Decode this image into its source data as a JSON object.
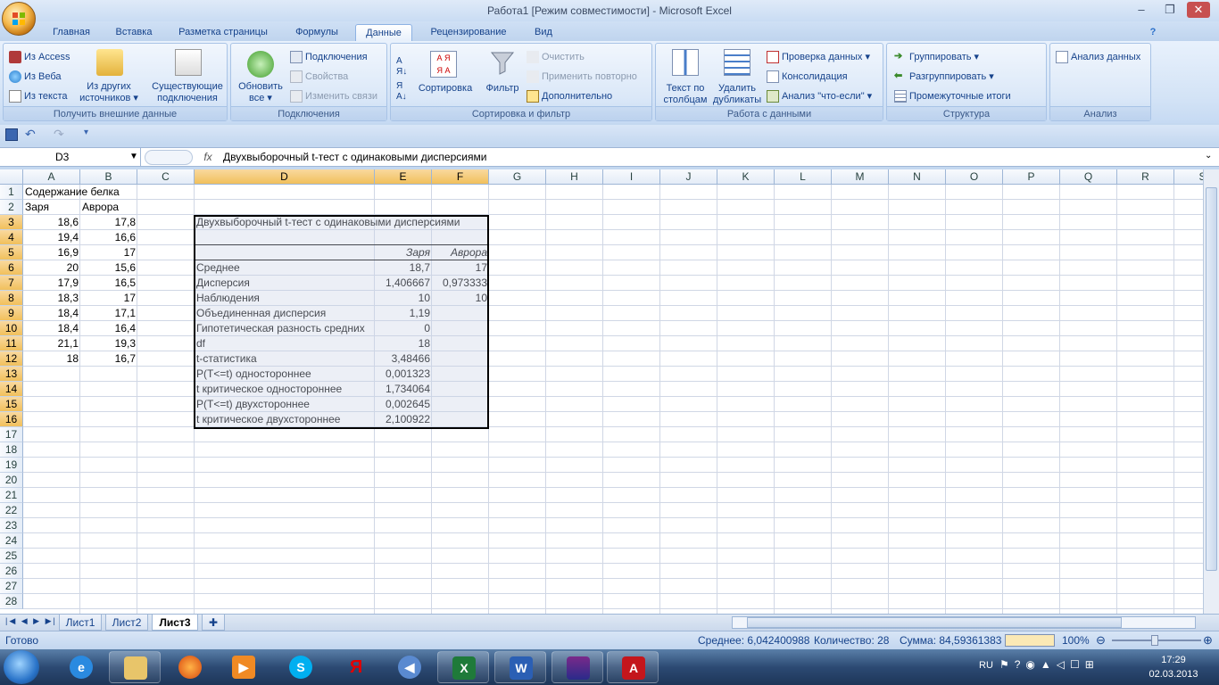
{
  "window": {
    "title": "Работа1  [Режим совместимости] - Microsoft Excel",
    "min": "–",
    "max": "❐",
    "close": "✕"
  },
  "tabs": [
    "Главная",
    "Вставка",
    "Разметка страницы",
    "Формулы",
    "Данные",
    "Рецензирование",
    "Вид"
  ],
  "active_tab": "Данные",
  "ribbon": {
    "g1": {
      "label": "Получить внешние данные",
      "access": "Из Access",
      "web": "Из Веба",
      "text": "Из текста",
      "other1": "Из других",
      "other2": "источников ▾",
      "exist1": "Существующие",
      "exist2": "подключения"
    },
    "g2": {
      "label": "Подключения",
      "refresh1": "Обновить",
      "refresh2": "все ▾",
      "connections": "Подключения",
      "properties": "Свойства",
      "edit_links": "Изменить связи"
    },
    "g3": {
      "label": "Сортировка и фильтр",
      "sort": "Сортировка",
      "filter": "Фильтр",
      "clear": "Очистить",
      "reapply": "Применить повторно",
      "advanced": "Дополнительно"
    },
    "g4": {
      "label": "Работа с данными",
      "ttc1": "Текст по",
      "ttc2": "столбцам",
      "dup1": "Удалить",
      "dup2": "дубликаты",
      "validation": "Проверка данных ▾",
      "consolidate": "Консолидация",
      "whatif": "Анализ \"что-если\" ▾"
    },
    "g5": {
      "label": "Структура",
      "group": "Группировать ▾",
      "ungroup": "Разгруппировать ▾",
      "subtotal": "Промежуточные итоги"
    },
    "g6": {
      "label": "Анализ",
      "analysis": "Анализ данных"
    }
  },
  "formula_bar": {
    "name_box": "D3",
    "fx": "fx",
    "formula": "Двухвыборочный t-тест с одинаковыми дисперсиями"
  },
  "columns": [
    "A",
    "B",
    "C",
    "D",
    "E",
    "F",
    "G",
    "H",
    "I",
    "J",
    "K",
    "L",
    "M",
    "N",
    "O",
    "P",
    "Q",
    "R",
    "S"
  ],
  "cells": {
    "A1": "Содержание белка",
    "A2": "Заря",
    "B2": "Аврора",
    "A3": "18,6",
    "B3": "17,8",
    "A4": "19,4",
    "B4": "16,6",
    "A5": "16,9",
    "B5": "17",
    "A6": "20",
    "B6": "15,6",
    "A7": "17,9",
    "B7": "16,5",
    "A8": "18,3",
    "B8": "17",
    "A9": "18,4",
    "B9": "17,1",
    "A10": "18,4",
    "B10": "16,4",
    "A11": "21,1",
    "B11": "19,3",
    "A12": "18",
    "B12": "16,7",
    "D3": "Двухвыборочный t-тест с одинаковыми дисперсиями",
    "E5": "Заря",
    "F5": "Аврора",
    "D6": "Среднее",
    "E6": "18,7",
    "F6": "17",
    "D7": "Дисперсия",
    "E7": "1,406667",
    "F7": "0,973333",
    "D8": "Наблюдения",
    "E8": "10",
    "F8": "10",
    "D9": "Объединенная дисперсия",
    "E9": "1,19",
    "D10": "Гипотетическая разность средних",
    "E10": "0",
    "D11": "df",
    "E11": "18",
    "D12": "t-статистика",
    "E12": "3,48466",
    "D13": "P(T<=t) одностороннее",
    "E13": "0,001323",
    "D14": "t критическое одностороннее",
    "E14": "1,734064",
    "D15": "P(T<=t) двухстороннее",
    "E15": "0,002645",
    "D16": "t критическое двухстороннее",
    "E16": "2,100922"
  },
  "sheets": [
    "Лист1",
    "Лист2",
    "Лист3"
  ],
  "active_sheet": "Лист3",
  "status": {
    "ready": "Готово",
    "average": "Среднее: 6,042400988",
    "count": "Количество: 28",
    "sum": "Сумма: 84,59361383",
    "zoom": "100%"
  },
  "taskbar": {
    "lang": "RU",
    "time": "17:29",
    "date": "02.03.2013"
  },
  "colors": {
    "accent": "#15428b",
    "selection": "#f1c05c",
    "grid": "#d0d7e5"
  }
}
